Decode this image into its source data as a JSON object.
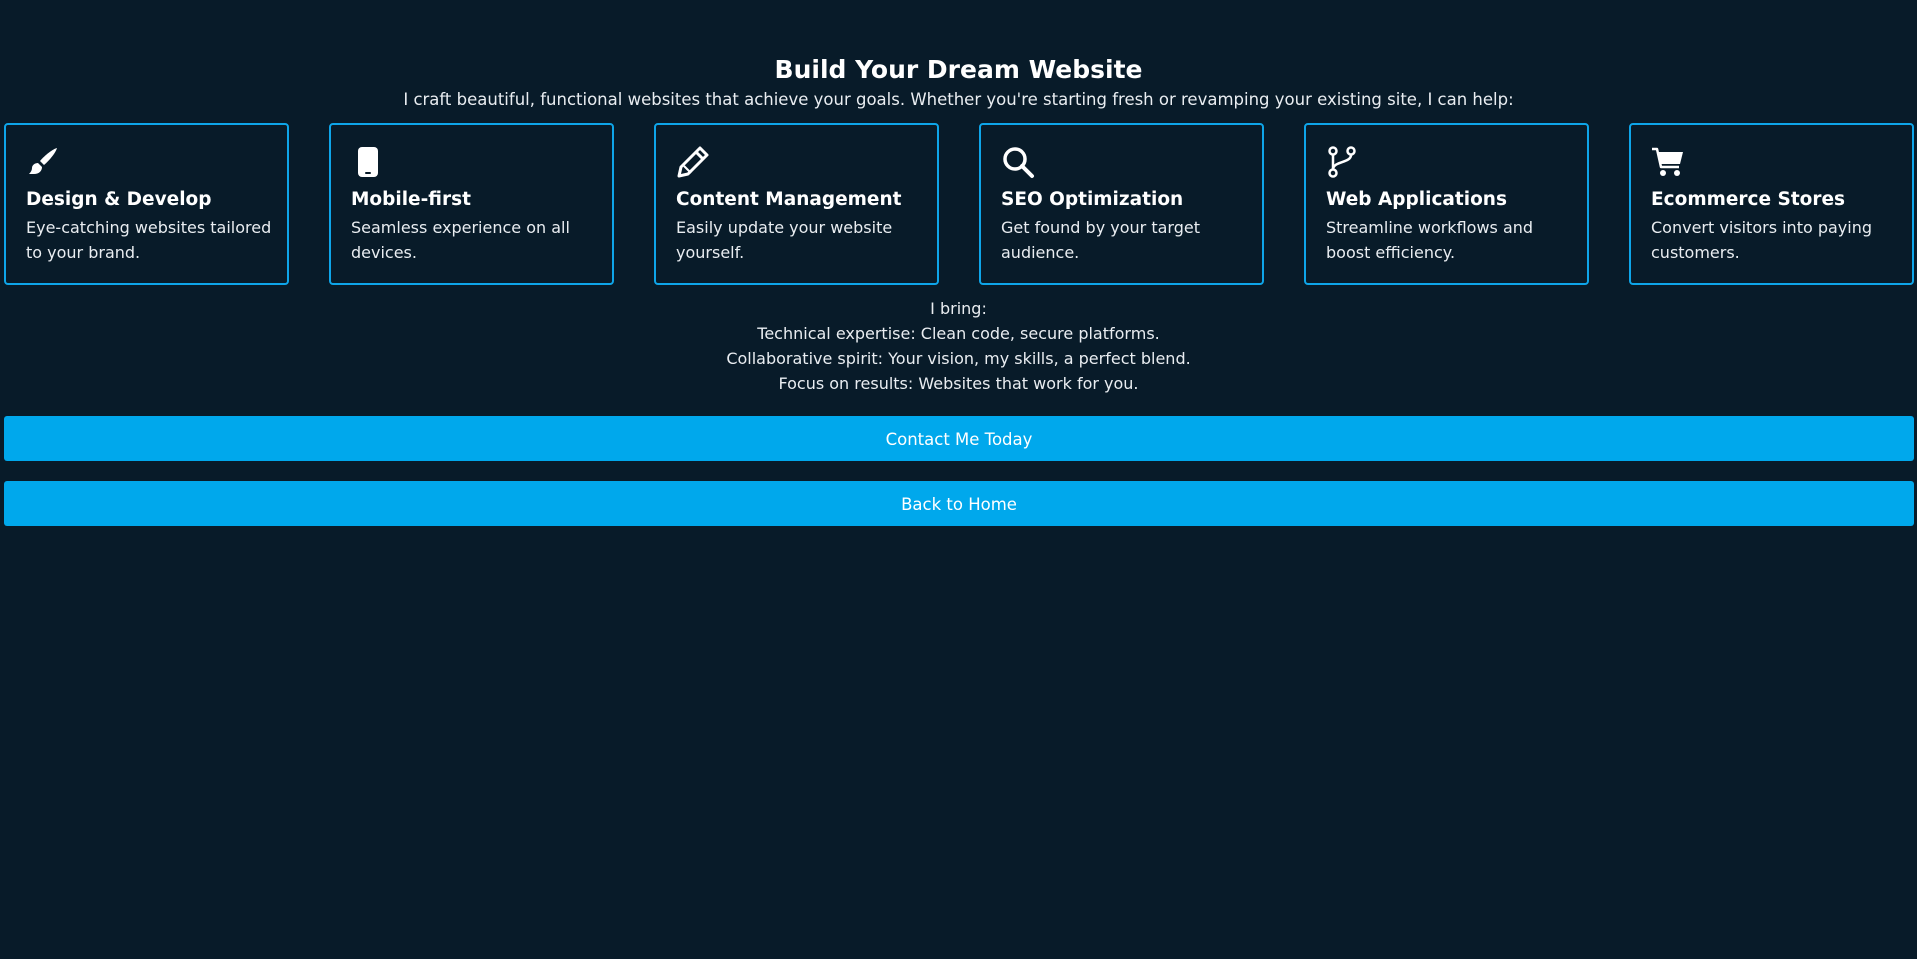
{
  "header": {
    "title": "Build Your Dream Website",
    "intro": "I craft beautiful, functional websites that achieve your goals. Whether you're starting fresh or revamping your existing site, I can help:"
  },
  "services": [
    {
      "icon": "paintbrush-icon",
      "title": "Design & Develop",
      "description": "Eye-catching websites tailored to your brand."
    },
    {
      "icon": "mobile-phone-icon",
      "title": "Mobile-first",
      "description": "Seamless experience on all devices."
    },
    {
      "icon": "pencil-icon",
      "title": "Content Management",
      "description": "Easily update your website yourself."
    },
    {
      "icon": "search-icon",
      "title": "SEO Optimization",
      "description": "Get found by your target audience."
    },
    {
      "icon": "code-branch-icon",
      "title": "Web Applications",
      "description": "Streamline workflows and boost efficiency."
    },
    {
      "icon": "shopping-cart-icon",
      "title": "Ecommerce Stores",
      "description": "Convert visitors into paying customers."
    }
  ],
  "bring": {
    "heading": "I bring:",
    "items": [
      "Technical expertise: Clean code, secure platforms.",
      "Collaborative spirit: Your vision, my skills, a perfect blend.",
      "Focus on results: Websites that work for you."
    ]
  },
  "buttons": {
    "contact_label": "Contact Me Today",
    "home_label": "Back to Home"
  },
  "colors": {
    "background": "#081b29",
    "accent": "#00a8ec",
    "card_border": "#0ea5e9",
    "text": "#ffffff"
  }
}
